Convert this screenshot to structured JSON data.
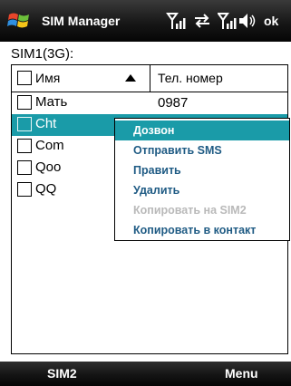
{
  "titlebar": {
    "title": "SIM Manager",
    "ok_label": "ok"
  },
  "section_label": "SIM1(3G):",
  "table": {
    "col_name": "Имя",
    "col_phone": "Тел. номер",
    "rows": [
      {
        "name": "Мать",
        "phone": "0987",
        "selected": false
      },
      {
        "name": "Cht",
        "phone": "",
        "selected": true
      },
      {
        "name": "Com",
        "phone": "",
        "selected": false
      },
      {
        "name": "Qoo",
        "phone": "",
        "selected": false
      },
      {
        "name": "QQ",
        "phone": "",
        "selected": false
      }
    ]
  },
  "context_menu": {
    "items": [
      {
        "label": "Дозвон",
        "state": "active"
      },
      {
        "label": "Отправить SMS",
        "state": "enabled"
      },
      {
        "label": "Править",
        "state": "enabled"
      },
      {
        "label": "Удалить",
        "state": "enabled"
      },
      {
        "label": "Копировать на SIM2",
        "state": "disabled"
      },
      {
        "label": "Копировать в контакт",
        "state": "enabled"
      }
    ]
  },
  "softkeys": {
    "left": "SIM2",
    "right": "Menu"
  },
  "colors": {
    "selection": "#1a9ba8",
    "menu_text": "#1f5b84",
    "disabled_text": "#b9b9b9"
  },
  "icons": {
    "start": "windows-flag-icon",
    "signal_3g": "signal-3g-icon",
    "sync": "sync-arrows-icon",
    "signal": "signal-icon",
    "volume": "speaker-icon"
  }
}
